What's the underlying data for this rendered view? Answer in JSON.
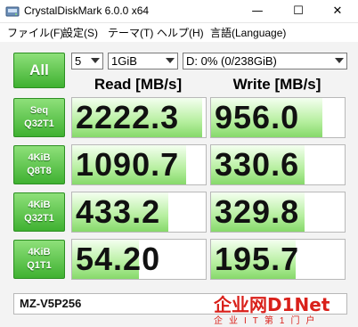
{
  "window": {
    "title": "CrystalDiskMark 6.0.0 x64",
    "minimize_glyph": "—",
    "maximize_glyph": "☐",
    "close_glyph": "✕"
  },
  "menu": [
    "ファイル(F)",
    "設定(S)",
    "テーマ(T)",
    "ヘルプ(H)",
    "言語(Language)"
  ],
  "controls": {
    "all_label": "All",
    "test_count": "5",
    "test_size": "1GiB",
    "drive": "D: 0% (0/238GiB)"
  },
  "columns": {
    "read": "Read [MB/s]",
    "write": "Write [MB/s]"
  },
  "rows": [
    {
      "line1": "Seq",
      "line2": "Q32T1",
      "read": "2222.3",
      "write": "956.0",
      "read_fill": 0.97,
      "write_fill": 0.83
    },
    {
      "line1": "4KiB",
      "line2": "Q8T8",
      "read": "1090.7",
      "write": "330.6",
      "read_fill": 0.85,
      "write_fill": 0.7
    },
    {
      "line1": "4KiB",
      "line2": "Q32T1",
      "read": "433.2",
      "write": "329.8",
      "read_fill": 0.72,
      "write_fill": 0.7
    },
    {
      "line1": "4KiB",
      "line2": "Q1T1",
      "read": "54.20",
      "write": "195.7",
      "read_fill": 0.5,
      "write_fill": 0.63
    }
  ],
  "comment": "MZ-V5P256",
  "watermark": {
    "main": "企业网D1Net",
    "sub": "企业IT第1门户"
  },
  "colors": {
    "accent_green": "#3fb131",
    "watermark_red": "#d9201a"
  }
}
